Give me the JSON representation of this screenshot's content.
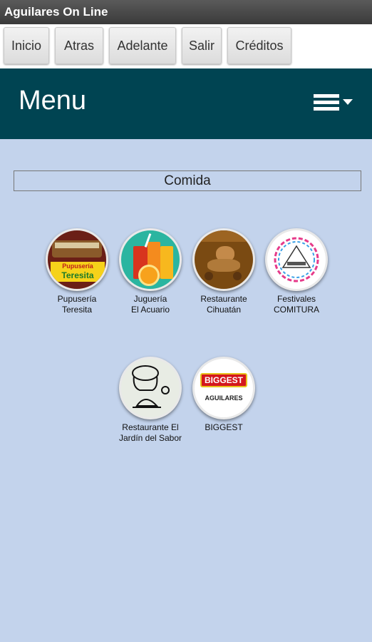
{
  "window": {
    "title": "Aguilares On Line"
  },
  "toolbar": {
    "buttons": [
      "Inicio",
      "Atras",
      "Adelante",
      "Salir",
      "Créditos"
    ]
  },
  "header": {
    "title": "Menu",
    "menu_icon": "hamburger-dropdown-icon"
  },
  "category": {
    "label": "Comida"
  },
  "apps": [
    {
      "label": "Pupusería\nTeresita",
      "icon_text": [
        "Pupusería",
        "Teresita"
      ],
      "icon": "pupuseria-teresita-logo"
    },
    {
      "label": "Juguería\nEl Acuario",
      "icon": "juice-glasses-icon"
    },
    {
      "label": "Restaurante\nCihuatán",
      "icon": "clay-jaguar-figure-icon"
    },
    {
      "label": "Festivales\nCOMITURA",
      "icon": "pyramid-festival-logo"
    },
    {
      "label": "Restaurante El\nJardín del Sabor",
      "icon": "chef-hat-icon"
    },
    {
      "label": "BIGGEST",
      "icon_text": [
        "BIGGEST",
        "AGUILARES"
      ],
      "icon": "biggest-logo"
    }
  ],
  "colors": {
    "header": "#004452",
    "background": "#c3d3ec",
    "titlebar": "#444444"
  }
}
